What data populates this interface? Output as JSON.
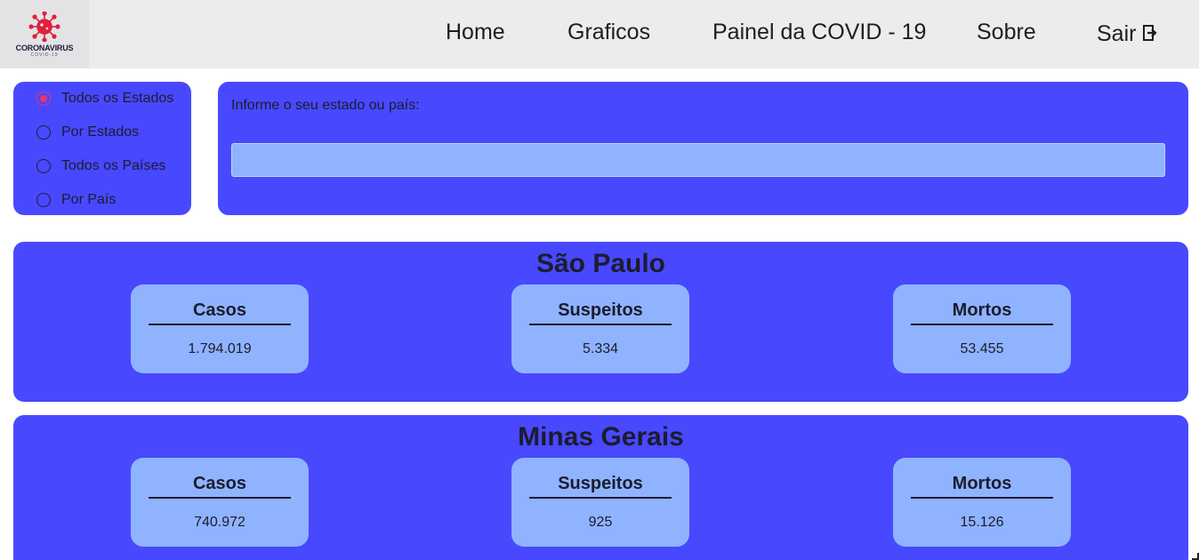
{
  "logo": {
    "text": "CORONAVIRUS",
    "sub": "COVID-19",
    "icon": "virus-icon",
    "color": "#e0203a"
  },
  "nav": {
    "home": "Home",
    "graficos": "Graficos",
    "painel": "Painel da COVID - 19",
    "sobre": "Sobre",
    "sair": "Sair",
    "sair_icon": "logout-icon"
  },
  "filters": {
    "options": [
      {
        "label": "Todos os Estados",
        "checked": true
      },
      {
        "label": "Por Estados",
        "checked": false
      },
      {
        "label": "Todos os Países",
        "checked": false
      },
      {
        "label": "Por País",
        "checked": false
      }
    ]
  },
  "search": {
    "label": "Informe o seu estado ou país:",
    "value": "",
    "placeholder": ""
  },
  "states": [
    {
      "name": "São Paulo",
      "stats": [
        {
          "title": "Casos",
          "value": "1.794.019"
        },
        {
          "title": "Suspeitos",
          "value": "5.334"
        },
        {
          "title": "Mortos",
          "value": "53.455"
        }
      ]
    },
    {
      "name": "Minas Gerais",
      "stats": [
        {
          "title": "Casos",
          "value": "740.972"
        },
        {
          "title": "Suspeitos",
          "value": "925"
        },
        {
          "title": "Mortos",
          "value": "15.126"
        }
      ]
    }
  ],
  "colors": {
    "panel": "#4848ff",
    "box": "#8fb3ff",
    "nav_bg": "#ececec",
    "radio_checked": "#e8346a"
  }
}
